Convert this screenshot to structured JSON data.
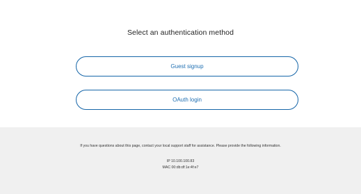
{
  "auth": {
    "title": "Select an authentication method",
    "guest_label": "Guest signup",
    "oauth_label": "OAuth login"
  },
  "footer": {
    "help_text": "If you have questions about this page, contact your local support staff for assistance. Please provide the following information.",
    "ip_line": "IP 10.100.100.83",
    "mac_line": "MAC 00:db:df:1e:4f:e7"
  },
  "colors": {
    "accent": "#1565a8",
    "footer_background": "#f0f0f0"
  }
}
